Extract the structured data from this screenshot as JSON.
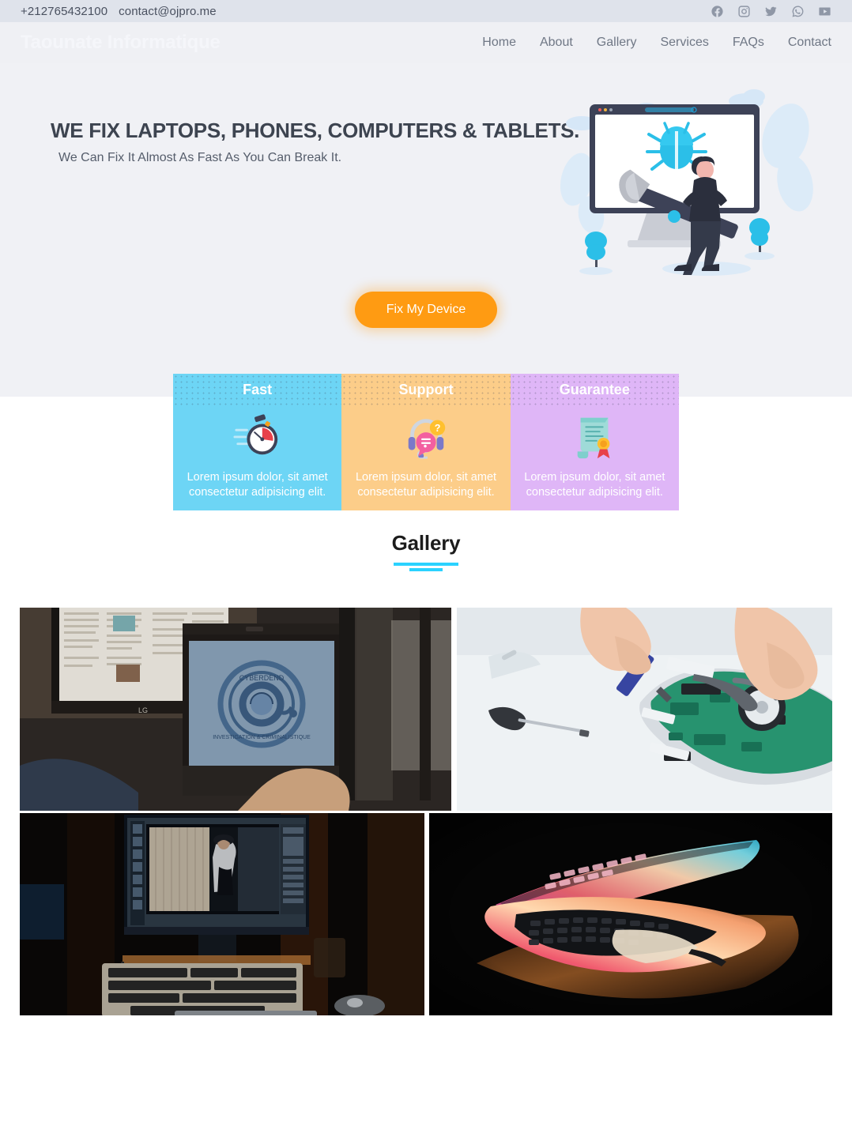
{
  "topbar": {
    "phone": "+212765432100",
    "email": "contact@ojpro.me",
    "socials": [
      {
        "name": "facebook-icon",
        "label": "Facebook"
      },
      {
        "name": "instagram-icon",
        "label": "Instagram"
      },
      {
        "name": "twitter-icon",
        "label": "Twitter"
      },
      {
        "name": "whatsapp-icon",
        "label": "WhatsApp"
      },
      {
        "name": "youtube-icon",
        "label": "YouTube"
      }
    ]
  },
  "nav": {
    "brand": "Taounate Informatique",
    "links": [
      {
        "label": "Home"
      },
      {
        "label": "About"
      },
      {
        "label": "Gallery"
      },
      {
        "label": "Services"
      },
      {
        "label": "FAQs"
      },
      {
        "label": "Contact"
      }
    ]
  },
  "hero": {
    "title": "WE FIX LAPTOPS, PHONES, COMPUTERS & TABLETS.",
    "subtitle": "We Can Fix It Almost As Fast As You Can Break It.",
    "cta_label": "Fix My Device",
    "illustration": "computer-bug-repair-illustration",
    "background_color": "#f0f1f5",
    "cta_color": "#ff9b12"
  },
  "features": [
    {
      "title": "Fast",
      "text": "Lorem ipsum dolor, sit amet consectetur adipisicing elit.",
      "icon": "stopwatch-icon",
      "color": "#6dd5f5"
    },
    {
      "title": "Support",
      "text": "Lorem ipsum dolor, sit amet consectetur adipisicing elit.",
      "icon": "headset-support-icon",
      "color": "#fccd89"
    },
    {
      "title": "Guarantee",
      "text": "Lorem ipsum dolor, sit amet consectetur adipisicing elit.",
      "icon": "certificate-icon",
      "color": "#dfb6f7"
    }
  ],
  "gallery": {
    "heading": "Gallery",
    "accent_color": "#2ad2ff",
    "items": [
      {
        "name": "gallery-image-workstation-laptop-logo"
      },
      {
        "name": "gallery-image-motherboard-repair"
      },
      {
        "name": "gallery-image-photo-editing-desk"
      },
      {
        "name": "gallery-image-glowing-laptop"
      }
    ]
  }
}
